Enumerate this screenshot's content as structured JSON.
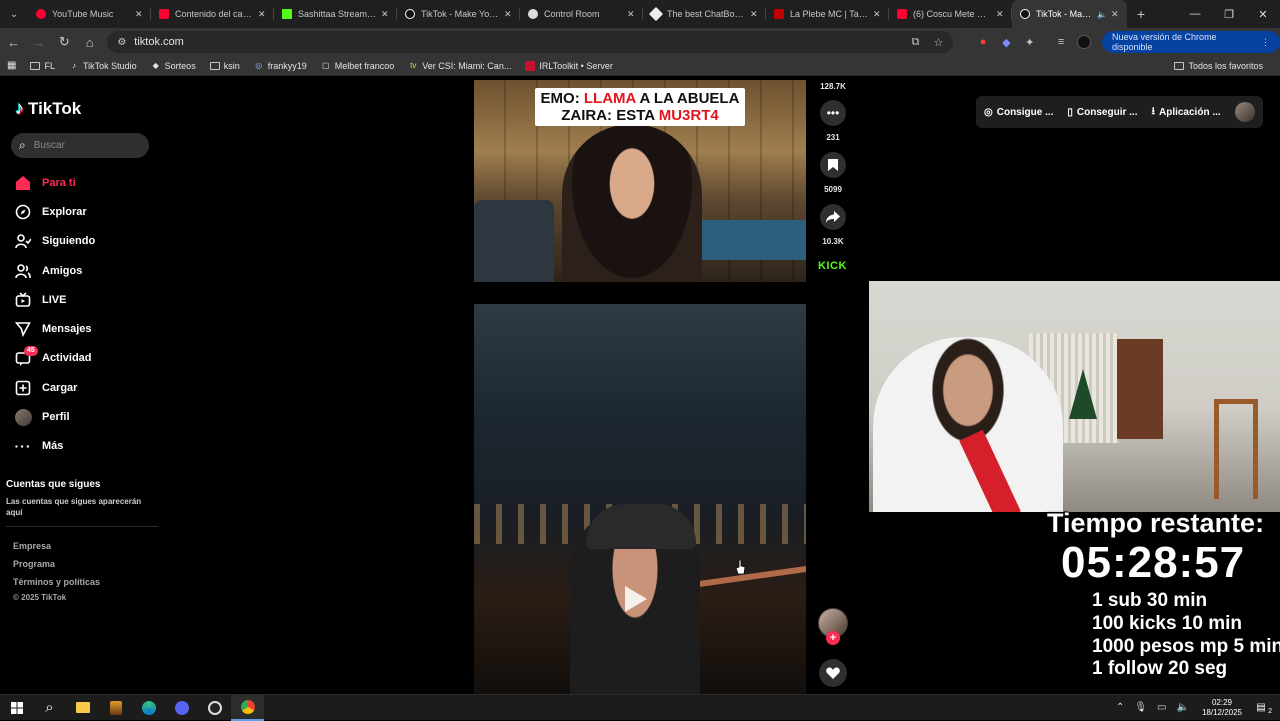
{
  "browser": {
    "tabs": [
      {
        "title": "YouTube Music",
        "color": "#ff0033"
      },
      {
        "title": "Contenido del canal -",
        "color": "#ff0033"
      },
      {
        "title": "Sashittaa Stream - W",
        "color": "#53fc18"
      },
      {
        "title": "TikTok - Make Your D",
        "color": "#ffffff"
      },
      {
        "title": "Control Room",
        "color": "#ffffff"
      },
      {
        "title": "The best ChatBot and",
        "color": "#ffffff"
      },
      {
        "title": "La Plebe MC | Tablero",
        "color": "#c00000"
      },
      {
        "title": "(6) Coscu Mete Un B",
        "color": "#ff0033"
      },
      {
        "title": "TikTok - Make You",
        "color": "#ffffff"
      }
    ],
    "active_tab_index": 8,
    "url": "tiktok.com",
    "update_button": "Nueva versión de Chrome disponible",
    "bookmarks": [
      "FL",
      "TikTok Studio",
      "Sorteos",
      "ksin",
      "frankyy19",
      "Melbet francoo",
      "Ver CSI: Miami: Can...",
      "IRLToolkit • Server"
    ],
    "all_bookmarks": "Todos los favoritos"
  },
  "sidebar": {
    "logo": "TikTok",
    "search_placeholder": "Buscar",
    "nav": [
      {
        "label": "Para ti",
        "icon": "home-icon",
        "active": true
      },
      {
        "label": "Explorar",
        "icon": "compass-icon"
      },
      {
        "label": "Siguiendo",
        "icon": "following-icon"
      },
      {
        "label": "Amigos",
        "icon": "friends-icon"
      },
      {
        "label": "LIVE",
        "icon": "live-icon"
      },
      {
        "label": "Mensajes",
        "icon": "messages-icon"
      },
      {
        "label": "Actividad",
        "icon": "activity-icon",
        "badge": "45"
      },
      {
        "label": "Cargar",
        "icon": "upload-icon"
      },
      {
        "label": "Perfil",
        "icon": "profile-avatar"
      },
      {
        "label": "Más",
        "icon": "more-icon"
      }
    ],
    "following_title": "Cuentas que sigues",
    "following_subtitle": "Las cuentas que sigues aparecerán aquí",
    "footer": [
      "Empresa",
      "Programa",
      "Términos y políticas",
      "© 2025 TikTok"
    ]
  },
  "video1": {
    "caption_line1_prefix": "EMO: ",
    "caption_line1_red": "LLAMA",
    "caption_line1_suffix": " A LA ABUELA",
    "caption_line2_prefix": "ZAIRA: ESTA ",
    "caption_line2_red": "MU3RT4",
    "likes": "128.7K",
    "comments": "231",
    "saves": "5099",
    "shares": "10.3K",
    "source_tag": "KICK"
  },
  "top_right": {
    "item1": "Consigue ...",
    "item2": "Conseguir ...",
    "item3": "Aplicación ..."
  },
  "stream_overlay": {
    "timer_label": "Tiempo restante:",
    "timer_value": "05:28:57",
    "rules": [
      "1 sub 30 min",
      "100 kicks 10 min",
      "1000 pesos mp 5 min",
      "1 follow 20 seg"
    ]
  },
  "taskbar": {
    "time": "02:29",
    "date": "18/12/2025",
    "notifications": "2"
  },
  "colors": {
    "tiktok_red": "#fe2c55",
    "kick_green": "#53fc18",
    "chrome_update": "#0842a0"
  }
}
